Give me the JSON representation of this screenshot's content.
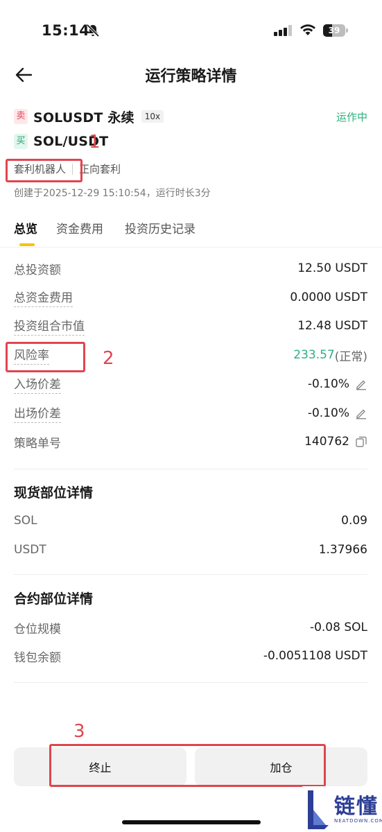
{
  "status_bar": {
    "time": "15:14",
    "battery": "39"
  },
  "nav": {
    "title": "运行策略详情"
  },
  "strategy": {
    "legs": [
      {
        "side": "卖",
        "pair": "SOLUSDT 永续",
        "leverage": "10x"
      },
      {
        "side": "买",
        "pair": "SOL/USDT"
      }
    ],
    "status": "运作中",
    "tags": [
      "套利机器人",
      "正向套利"
    ],
    "created": "创建于2025-12-29 15:10:54，运行时长3分"
  },
  "tabs": [
    "总览",
    "资金费用",
    "投资历史记录"
  ],
  "overview": [
    {
      "label": "总投资额",
      "value": "12.50 USDT"
    },
    {
      "label": "总资金费用",
      "value": "0.0000 USDT"
    },
    {
      "label": "投资组合市值",
      "value": "12.48 USDT"
    },
    {
      "label": "风险率",
      "value": "233.57",
      "suffix": "(正常)"
    },
    {
      "label": "入场价差",
      "value": "-0.10%"
    },
    {
      "label": "出场价差",
      "value": "-0.10%"
    },
    {
      "label": "策略单号",
      "value": "140762"
    }
  ],
  "spot": {
    "title": "现货部位详情",
    "rows": [
      {
        "label": "SOL",
        "value": "0.09"
      },
      {
        "label": "USDT",
        "value": "1.37966"
      }
    ]
  },
  "futures": {
    "title": "合约部位详情",
    "rows": [
      {
        "label": "仓位规模",
        "value": "-0.08 SOL"
      },
      {
        "label": "钱包余额",
        "value": "-0.0051108 USDT"
      }
    ]
  },
  "buttons": {
    "stop": "终止",
    "add": "加仓"
  },
  "annotations": [
    "1",
    "2",
    "3"
  ],
  "watermark": {
    "text": "链懂",
    "sub": "NEATDOWN.COM"
  },
  "colors": {
    "accent": "#f5c400",
    "positive": "#2bb07f",
    "sell": "#e5485b",
    "annotation": "#e0454d"
  }
}
